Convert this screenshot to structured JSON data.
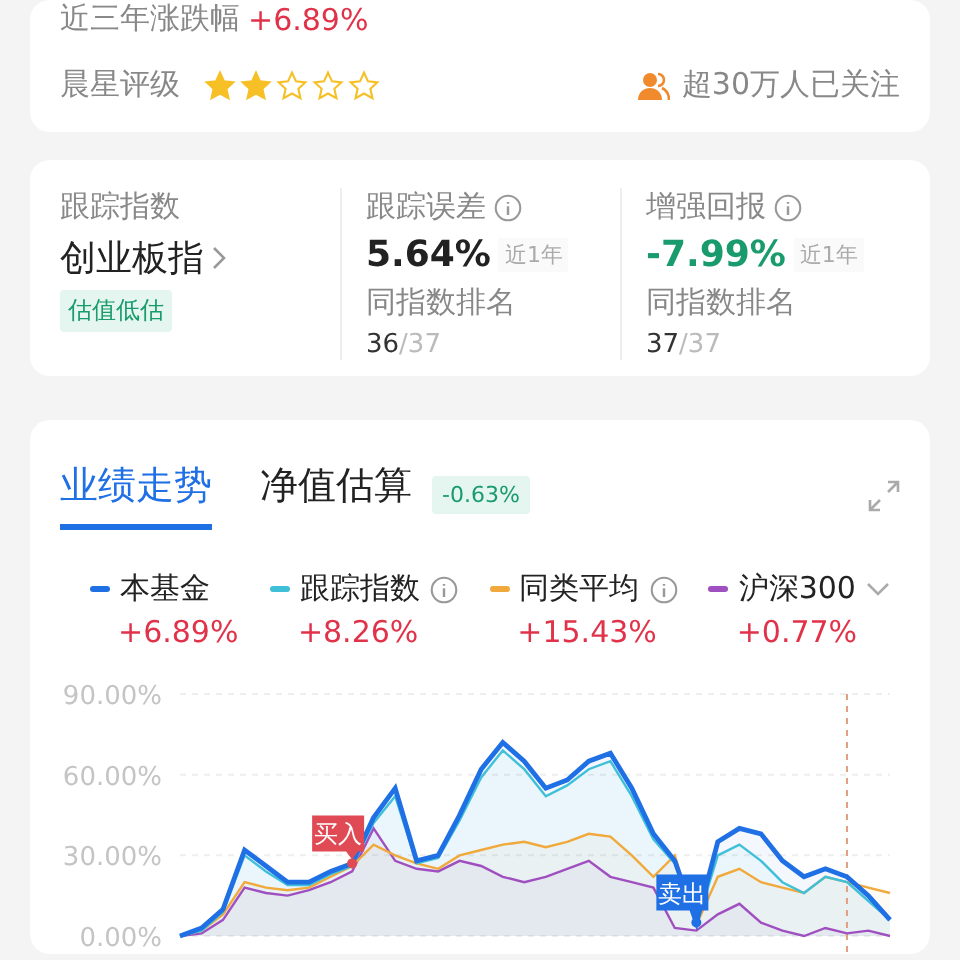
{
  "summary": {
    "label": "近三年涨跌幅",
    "value": "+6.89%"
  },
  "rating": {
    "label": "晨星评级",
    "stars": 2
  },
  "followers": "超30万人已关注",
  "tracking": {
    "index_label": "跟踪指数",
    "index_name": "创业板指",
    "valuation_tag": "估值低估",
    "metrics": [
      {
        "label": "跟踪误差",
        "value": "5.64%",
        "color": "#222222",
        "period": "近1年",
        "rank_label": "同指数排名",
        "rank": "36",
        "rank_of": "/37"
      },
      {
        "label": "增强回报",
        "value": "-7.99%",
        "color": "#199b6d",
        "period": "近1年",
        "rank_label": "同指数排名",
        "rank": "37",
        "rank_of": "/37"
      }
    ]
  },
  "performance": {
    "tabs": [
      {
        "label": "业绩走势",
        "selected": true
      },
      {
        "label": "净值估算",
        "selected": false,
        "badge": "-0.63%"
      }
    ],
    "legend": [
      {
        "value": "+6.89%",
        "info": false,
        "dropdown": false
      },
      {
        "value": "+8.26%",
        "info": true,
        "dropdown": false
      },
      {
        "value": "+15.43%",
        "info": true,
        "dropdown": false
      },
      {
        "value": "+0.77%",
        "info": false,
        "dropdown": true
      }
    ],
    "chart_data": {
      "type": "area",
      "ylim": [
        0,
        90
      ],
      "yticks": [
        {
          "value": 0,
          "label": "0.00%"
        },
        {
          "value": 30,
          "label": "30.00%"
        },
        {
          "value": 60,
          "label": "60.00%"
        },
        {
          "value": 90,
          "label": "90.00%"
        }
      ],
      "series": [
        {
          "name": "本基金",
          "color": "#1f6fe5",
          "values": [
            0,
            3,
            10,
            32,
            26,
            20,
            20,
            24,
            27,
            44,
            55,
            28,
            30,
            45,
            62,
            72,
            65,
            55,
            58,
            65,
            68,
            55,
            38,
            28,
            5,
            35,
            40,
            38,
            28,
            22,
            25,
            22,
            15,
            6
          ]
        },
        {
          "name": "跟踪指数",
          "color": "#3fc0d8",
          "values": [
            0,
            2,
            9,
            30,
            24,
            19,
            19,
            23,
            26,
            42,
            52,
            27,
            29,
            43,
            59,
            69,
            62,
            52,
            56,
            62,
            65,
            52,
            36,
            27,
            4,
            30,
            34,
            28,
            20,
            16,
            22,
            20,
            13,
            6
          ]
        },
        {
          "name": "同类平均",
          "color": "#f0a93a",
          "values": [
            0,
            2,
            8,
            20,
            18,
            17,
            18,
            22,
            26,
            34,
            30,
            27,
            25,
            30,
            32,
            34,
            35,
            33,
            35,
            38,
            37,
            30,
            22,
            30,
            4,
            22,
            25,
            20,
            18,
            16,
            22,
            20,
            18,
            16
          ]
        },
        {
          "name": "沪深300",
          "color": "#a04fc0",
          "values": [
            0,
            1,
            6,
            18,
            16,
            15,
            17,
            20,
            24,
            40,
            28,
            25,
            24,
            28,
            26,
            22,
            20,
            22,
            25,
            28,
            22,
            20,
            18,
            3,
            2,
            8,
            12,
            5,
            2,
            0,
            3,
            1,
            2,
            0
          ]
        }
      ]
    },
    "trade_marks": [
      {
        "kind": "buy",
        "label": "买入"
      },
      {
        "kind": "sell",
        "label": "卖出"
      }
    ]
  }
}
